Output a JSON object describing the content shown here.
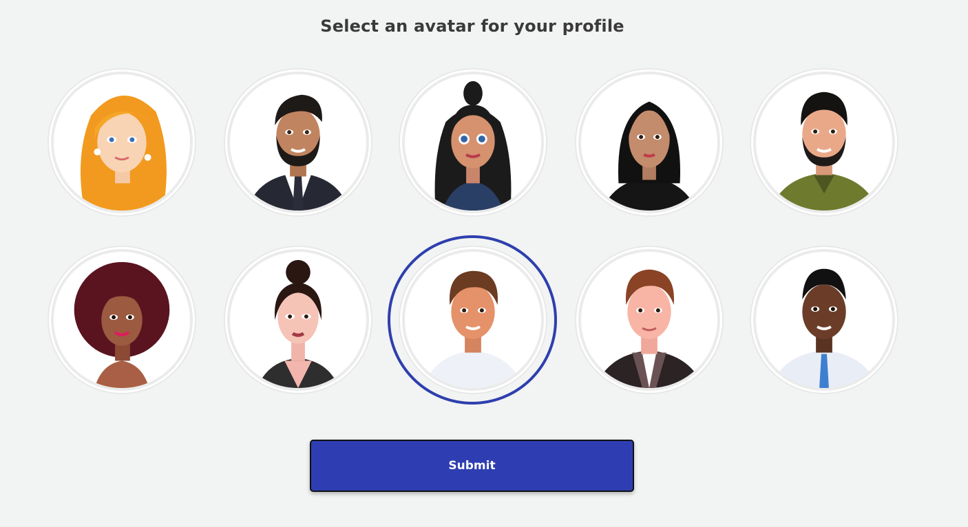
{
  "title": "Select an avatar for your profile",
  "avatars": [
    {
      "name": "avatar-woman-orange-hair",
      "selected": false
    },
    {
      "name": "avatar-man-suit-beard",
      "selected": false
    },
    {
      "name": "avatar-woman-ponytail",
      "selected": false
    },
    {
      "name": "avatar-woman-black-bob",
      "selected": false
    },
    {
      "name": "avatar-man-green-jacket-beard",
      "selected": false
    },
    {
      "name": "avatar-woman-curly-hair",
      "selected": false
    },
    {
      "name": "avatar-woman-hair-bun",
      "selected": false
    },
    {
      "name": "avatar-man-white-tshirt",
      "selected": true
    },
    {
      "name": "avatar-man-dark-jacket",
      "selected": false
    },
    {
      "name": "avatar-man-white-shirt-tie",
      "selected": false
    }
  ],
  "submit_label": "Submit",
  "colors": {
    "accent": "#2e3eb2",
    "selection_ring": "#2e3fad",
    "background": "#f2f3f3"
  }
}
